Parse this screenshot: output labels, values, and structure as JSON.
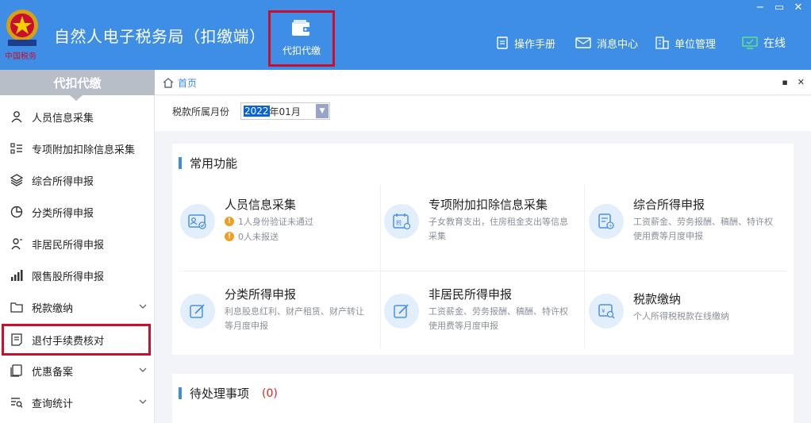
{
  "header": {
    "app_title": "自然人电子税务局（扣缴端）",
    "module_label": "代扣代缴",
    "links": [
      {
        "label": "操作手册",
        "icon": "manual-icon"
      },
      {
        "label": "消息中心",
        "icon": "message-icon"
      },
      {
        "label": "单位管理",
        "icon": "unit-management-icon"
      },
      {
        "label": "在线",
        "icon": "online-monitor-icon"
      }
    ],
    "accent_color": "#3f8ee6"
  },
  "sidebar": {
    "title": "代扣代缴",
    "items": [
      {
        "label": "人员信息采集",
        "icon": "person-icon",
        "expandable": false
      },
      {
        "label": "专项附加扣除信息采集",
        "icon": "list-icon",
        "expandable": false
      },
      {
        "label": "综合所得申报",
        "icon": "layers-icon",
        "expandable": false
      },
      {
        "label": "分类所得申报",
        "icon": "pie-icon",
        "expandable": false
      },
      {
        "label": "非居民所得申报",
        "icon": "person-outline-icon",
        "expandable": false
      },
      {
        "label": "限售股所得申报",
        "icon": "bar-chart-icon",
        "expandable": false
      },
      {
        "label": "税款缴纳",
        "icon": "folder-icon",
        "expandable": true
      },
      {
        "label": "退付手续费核对",
        "icon": "document-icon",
        "expandable": false,
        "highlighted": true
      },
      {
        "label": "优惠备案",
        "icon": "copy-icon",
        "expandable": true
      },
      {
        "label": "查询统计",
        "icon": "search-list-icon",
        "expandable": true
      }
    ]
  },
  "breadcrumb": {
    "home": "首页"
  },
  "filter": {
    "label": "税款所属月份",
    "value_year": "2022",
    "value_rest": "年01月"
  },
  "common": {
    "title": "常用功能",
    "features": [
      {
        "title": "人员信息采集",
        "icon": "person-card-icon",
        "alerts": [
          "1人身份验证未通过",
          "0人未报送"
        ]
      },
      {
        "title": "专项附加扣除信息采集",
        "icon": "tax-calendar-icon",
        "desc": "子女教育支出，住房租金支出等信息采集"
      },
      {
        "title": "综合所得申报",
        "icon": "report-icon",
        "desc": "工资薪金、劳务报酬、稿酬、特许权使用费等月度申报"
      },
      {
        "title": "分类所得申报",
        "icon": "edit-icon",
        "desc": "利息股息红利、财产租赁、财产转让等月度申报"
      },
      {
        "title": "非居民所得申报",
        "icon": "edit-icon",
        "desc": "工资薪金、劳务报酬、稿酬、特许权使用费等月度申报"
      },
      {
        "title": "税款缴纳",
        "icon": "payment-search-icon",
        "desc": "个人所得税税款在线缴纳"
      }
    ]
  },
  "pending": {
    "title": "待处理事项",
    "count": "(0)"
  }
}
